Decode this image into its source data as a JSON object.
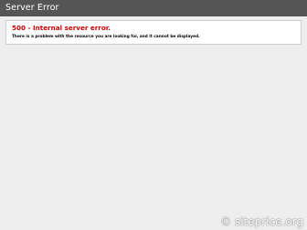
{
  "header": {
    "title": "Server Error"
  },
  "error": {
    "title": "500 - Internal server error.",
    "description": "There is a problem with the resource you are looking for, and it cannot be displayed."
  },
  "watermark": {
    "text": "© siteprice.org"
  },
  "colors": {
    "header_bg": "#555555",
    "error_title": "#cc0000",
    "page_bg": "#eeeeee"
  }
}
